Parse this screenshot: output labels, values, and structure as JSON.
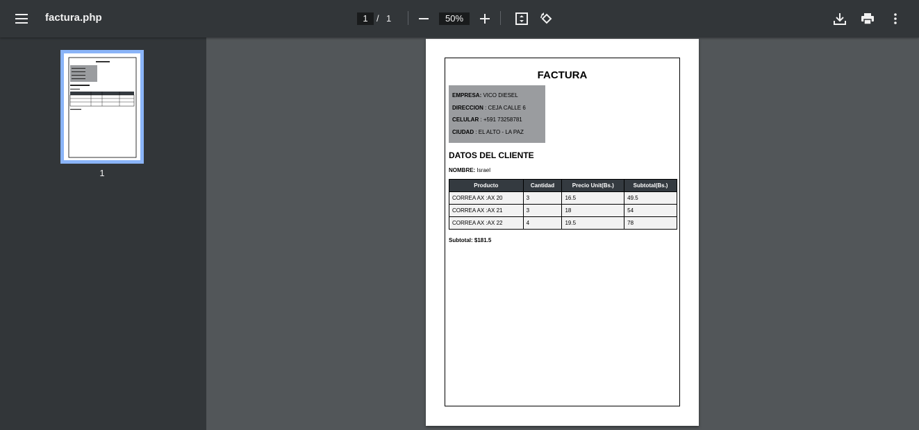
{
  "toolbar": {
    "title": "factura.php",
    "current_page": "1",
    "page_separator": "/",
    "total_pages": "1",
    "zoom": "50%",
    "icons": [
      "menu-icon",
      "zoom-out-icon",
      "zoom-in-icon",
      "fit-page-icon",
      "rotate-icon",
      "download-icon",
      "print-icon",
      "more-icon"
    ]
  },
  "sidebar": {
    "thumbnails": [
      {
        "label": "1"
      }
    ]
  },
  "document": {
    "title": "FACTURA",
    "company": {
      "empresa_label": "EMPRESA:",
      "empresa_value": " VICO DIESEL",
      "direccion_label": "DIRECCION",
      "direccion_value": " : CEJA CALLE 6",
      "celular_label": "CELULAR",
      "celular_value": " : +591 73258781",
      "ciudad_label": "CIUDAD",
      "ciudad_value": " : EL ALTO - LA PAZ"
    },
    "client_heading": "DATOS DEL CLIENTE",
    "client_label": "NOMBRE:",
    "client_value": " Israel",
    "table": {
      "headers": [
        "Producto",
        "Cantidad",
        "Precio Unit(Bs.)",
        "Subtotal(Bs.)"
      ],
      "rows": [
        [
          "CORREA AX :AX 20",
          "3",
          "16.5",
          "49.5"
        ],
        [
          "CORREA AX :AX 21",
          "3",
          "18",
          "54"
        ],
        [
          "CORREA AX :AX 22",
          "4",
          "19.5",
          "78"
        ]
      ]
    },
    "subtotal": "Subtotal: $181.5"
  }
}
